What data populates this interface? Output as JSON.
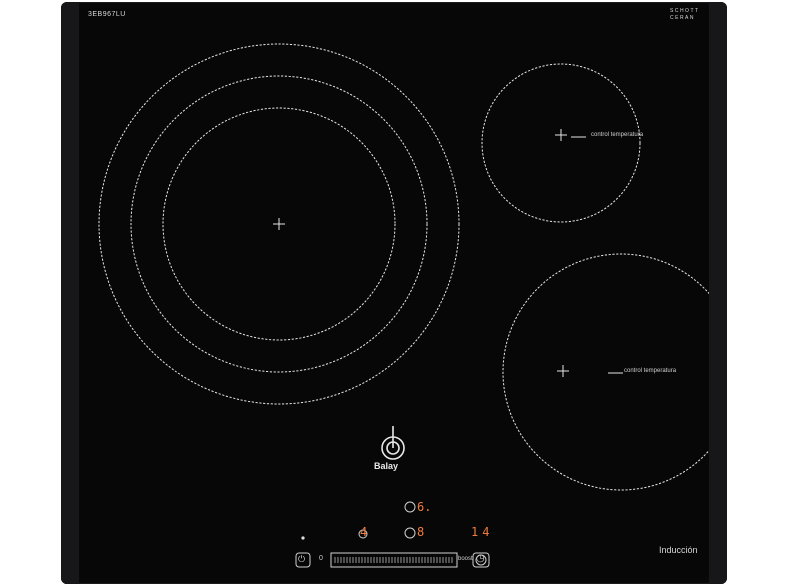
{
  "product": {
    "model_code": "3EB967LU",
    "glass_brand_line1": "SCHOTT",
    "glass_brand_line2": "CERAN",
    "glass_brand_line3": "",
    "brand_name": "Balay",
    "type_label": "Inducción"
  },
  "zones": {
    "top_right_label": "control temperatura",
    "bottom_right_label": "control temperatura"
  },
  "displays": {
    "left_value": "4",
    "center_top_value": "6.",
    "center_bottom_value": "8",
    "right_value": "14"
  },
  "controls": {
    "boost_label": "boost",
    "slider_scale": "0",
    "timer_symbol": "◷",
    "power_symbol": "⏻"
  },
  "colors": {
    "glass": "#070708",
    "print": "#d9d9d9",
    "display": "#f07a3a"
  }
}
